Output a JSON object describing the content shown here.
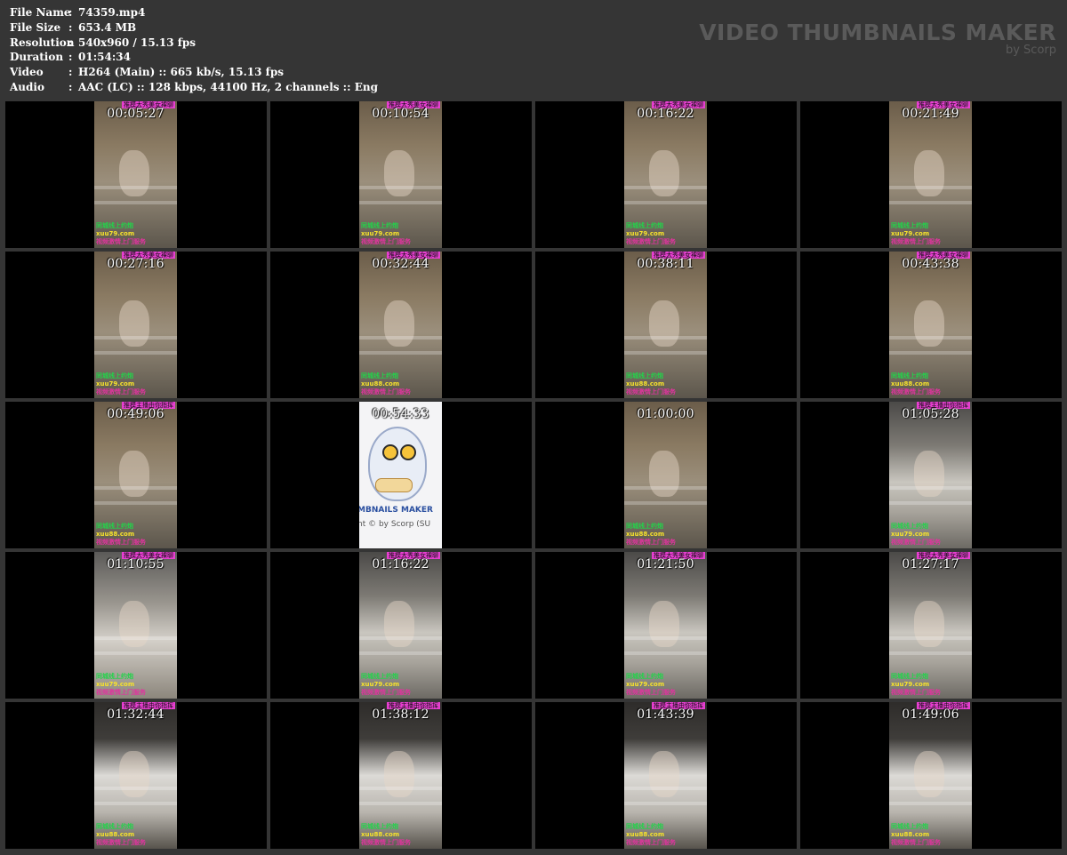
{
  "info": {
    "rows": [
      {
        "label": "File Name",
        "value": "74359.mp4"
      },
      {
        "label": "File Size",
        "value": "653.4 MB"
      },
      {
        "label": "Resolution",
        "value": "540x960 / 15.13 fps"
      },
      {
        "label": "Duration",
        "value": "01:54:34"
      },
      {
        "label": "Video",
        "value": "H264 (Main) :: 665 kb/s, 15.13 fps"
      },
      {
        "label": "Audio",
        "value": "AAC (LC) :: 128 kbps, 44100 Hz, 2 channels :: Eng"
      }
    ],
    "separator": ":"
  },
  "brand": {
    "title": "VIDEO THUMBNAILS MAKER",
    "subtitle": "by Scorp"
  },
  "thumbnails": [
    {
      "time": "00:05:27",
      "top": "推模大秀美女裸聊",
      "l1": "同城线上约炮",
      "l2": "xuu79.com",
      "l3": "视频激情上门服务",
      "scene": "a"
    },
    {
      "time": "00:10:54",
      "top": "推模大秀美女裸聊",
      "l1": "同城线上约炮",
      "l2": "xuu79.com",
      "l3": "视频激情上门服务",
      "scene": "a"
    },
    {
      "time": "00:16:22",
      "top": "推模大秀美女裸聊",
      "l1": "同城线上约炮",
      "l2": "xuu79.com",
      "l3": "视频激情上门服务",
      "scene": "a"
    },
    {
      "time": "00:21:49",
      "top": "推模大秀美女裸聊",
      "l1": "同城线上约炮",
      "l2": "xuu79.com",
      "l3": "视频激情上门服务",
      "scene": "a"
    },
    {
      "time": "00:27:16",
      "top": "推模大秀美女裸聊",
      "l1": "同城线上约炮",
      "l2": "xuu79.com",
      "l3": "视频激情上门服务",
      "scene": "a"
    },
    {
      "time": "00:32:44",
      "top": "推模大秀美女裸聊",
      "l1": "同城线上约炮",
      "l2": "xuu88.com",
      "l3": "视频激情上门服务",
      "scene": "a"
    },
    {
      "time": "00:38:11",
      "top": "推模大秀美女裸聊",
      "l1": "同城线上约炮",
      "l2": "xuu88.com",
      "l3": "视频激情上门服务",
      "scene": "a"
    },
    {
      "time": "00:43:38",
      "top": "推模大秀美女裸聊",
      "l1": "同城线上约炮",
      "l2": "xuu88.com",
      "l3": "视频激情上门服务",
      "scene": "a"
    },
    {
      "time": "00:49:06",
      "top": "推模主播由你指挥",
      "l1": "同城线上约炮",
      "l2": "xuu88.com",
      "l3": "视频激情上门服务",
      "scene": "a"
    },
    {
      "time": "00:54:33",
      "top": "",
      "l1": "",
      "l2": "",
      "l3": "",
      "scene": "owl",
      "owl1": "MBNAILS MAKER",
      "owl2": "nt © by Scorp (SU"
    },
    {
      "time": "01:00:00",
      "top": "",
      "l1": "同城线上约炮",
      "l2": "xuu88.com",
      "l3": "视频激情上门服务",
      "scene": "a"
    },
    {
      "time": "01:05:28",
      "top": "推模主播由你指挥",
      "l1": "同城线上约炮",
      "l2": "xuu79.com",
      "l3": "视频激情上门服务",
      "scene": "b"
    },
    {
      "time": "01:10:55",
      "top": "推模大秀美女裸聊",
      "l1": "同城线上约炮",
      "l2": "xuu79.com",
      "l3": "视频激情上门服务",
      "scene": "d"
    },
    {
      "time": "01:16:22",
      "top": "推模大秀美女裸聊",
      "l1": "同城线上约炮",
      "l2": "xuu79.com",
      "l3": "视频激情上门服务",
      "scene": "b"
    },
    {
      "time": "01:21:50",
      "top": "推模大秀美女裸聊",
      "l1": "同城线上约炮",
      "l2": "xuu79.com",
      "l3": "视频激情上门服务",
      "scene": "b"
    },
    {
      "time": "01:27:17",
      "top": "推模大秀美女裸聊",
      "l1": "同城线上约炮",
      "l2": "xuu79.com",
      "l3": "视频激情上门服务",
      "scene": "b"
    },
    {
      "time": "01:32:44",
      "top": "推模主播由你指挥",
      "l1": "同城线上约炮",
      "l2": "xuu88.com",
      "l3": "视频激情上门服务",
      "scene": "c"
    },
    {
      "time": "01:38:12",
      "top": "推模主播由你指挥",
      "l1": "同城线上约炮",
      "l2": "xuu88.com",
      "l3": "视频激情上门服务",
      "scene": "c"
    },
    {
      "time": "01:43:39",
      "top": "推模主播由你指挥",
      "l1": "同城线上约炮",
      "l2": "xuu88.com",
      "l3": "视频激情上门服务",
      "scene": "c"
    },
    {
      "time": "01:49:06",
      "top": "推模主播由你指挥",
      "l1": "同城线上约炮",
      "l2": "xuu88.com",
      "l3": "视频激情上门服务",
      "scene": "c"
    }
  ]
}
